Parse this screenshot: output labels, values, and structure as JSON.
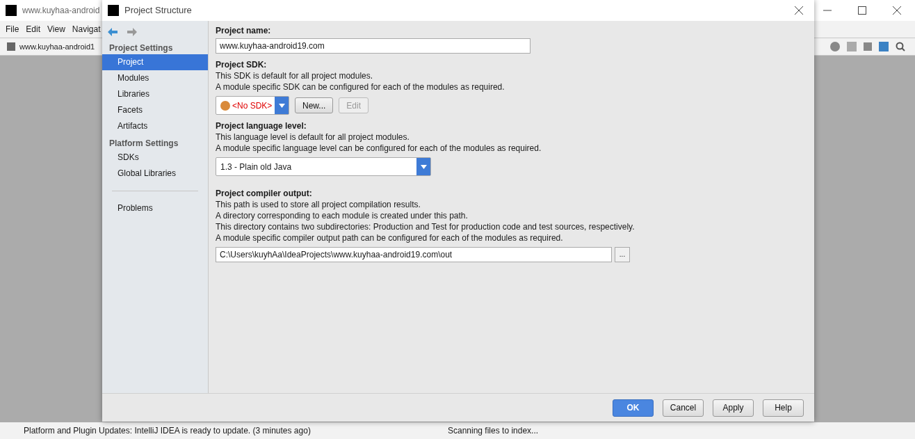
{
  "ide": {
    "title": "www.kuyhaa-android",
    "menu": [
      "File",
      "Edit",
      "View",
      "Navigat"
    ],
    "breadcrumb": "www.kuyhaa-android1",
    "status": "Platform and Plugin Updates: IntelliJ IDEA is ready to update. (3 minutes ago)",
    "status_2": "Scanning files to index..."
  },
  "dialog": {
    "title": "Project Structure",
    "sidebar": [
      {
        "heading": "Project Settings",
        "items": [
          {
            "label": "Project",
            "selected": true
          },
          {
            "label": "Modules",
            "selected": false
          },
          {
            "label": "Libraries",
            "selected": false
          },
          {
            "label": "Facets",
            "selected": false
          },
          {
            "label": "Artifacts",
            "selected": false
          }
        ]
      },
      {
        "heading": "Platform Settings",
        "items": [
          {
            "label": "SDKs",
            "selected": false
          },
          {
            "label": "Global Libraries",
            "selected": false
          }
        ]
      },
      {
        "items": [
          {
            "label": "Problems",
            "selected": false
          }
        ]
      }
    ],
    "project_name": {
      "label": "Project name:",
      "value": "www.kuyhaa-android19.com"
    },
    "sdk": {
      "label": "Project SDK:",
      "lines": [
        "This SDK is default for all project modules.",
        "A module specific SDK can be configured for each of the modules as required."
      ],
      "value": "<No SDK>",
      "buttons": [
        {
          "label": "New...",
          "disabled": false
        },
        {
          "label": "Edit",
          "disabled": true
        }
      ]
    },
    "language": {
      "label": "Project language level:",
      "lines": [
        "This language level is default for all project modules.",
        "A module specific language level can be configured for each of the modules as required."
      ],
      "value": "1.3 - Plain old Java"
    },
    "output": {
      "label": "Project compiler output:",
      "lines": [
        "This path is used to store all project compilation results.",
        "A directory corresponding to each module is created under this path.",
        "This directory contains two subdirectories: Production and Test for production code and test sources, respectively.",
        "A module specific compiler output path can be configured for each of the modules as required."
      ],
      "value": "C:\\Users\\kuyhAa\\IdeaProjects\\www.kuyhaa-android19.com\\out",
      "browse": "..."
    },
    "buttons": [
      {
        "label": "OK",
        "primary": true
      },
      {
        "label": "Cancel",
        "primary": false
      },
      {
        "label": "Apply",
        "primary": false
      },
      {
        "label": "Help",
        "primary": false
      }
    ]
  }
}
